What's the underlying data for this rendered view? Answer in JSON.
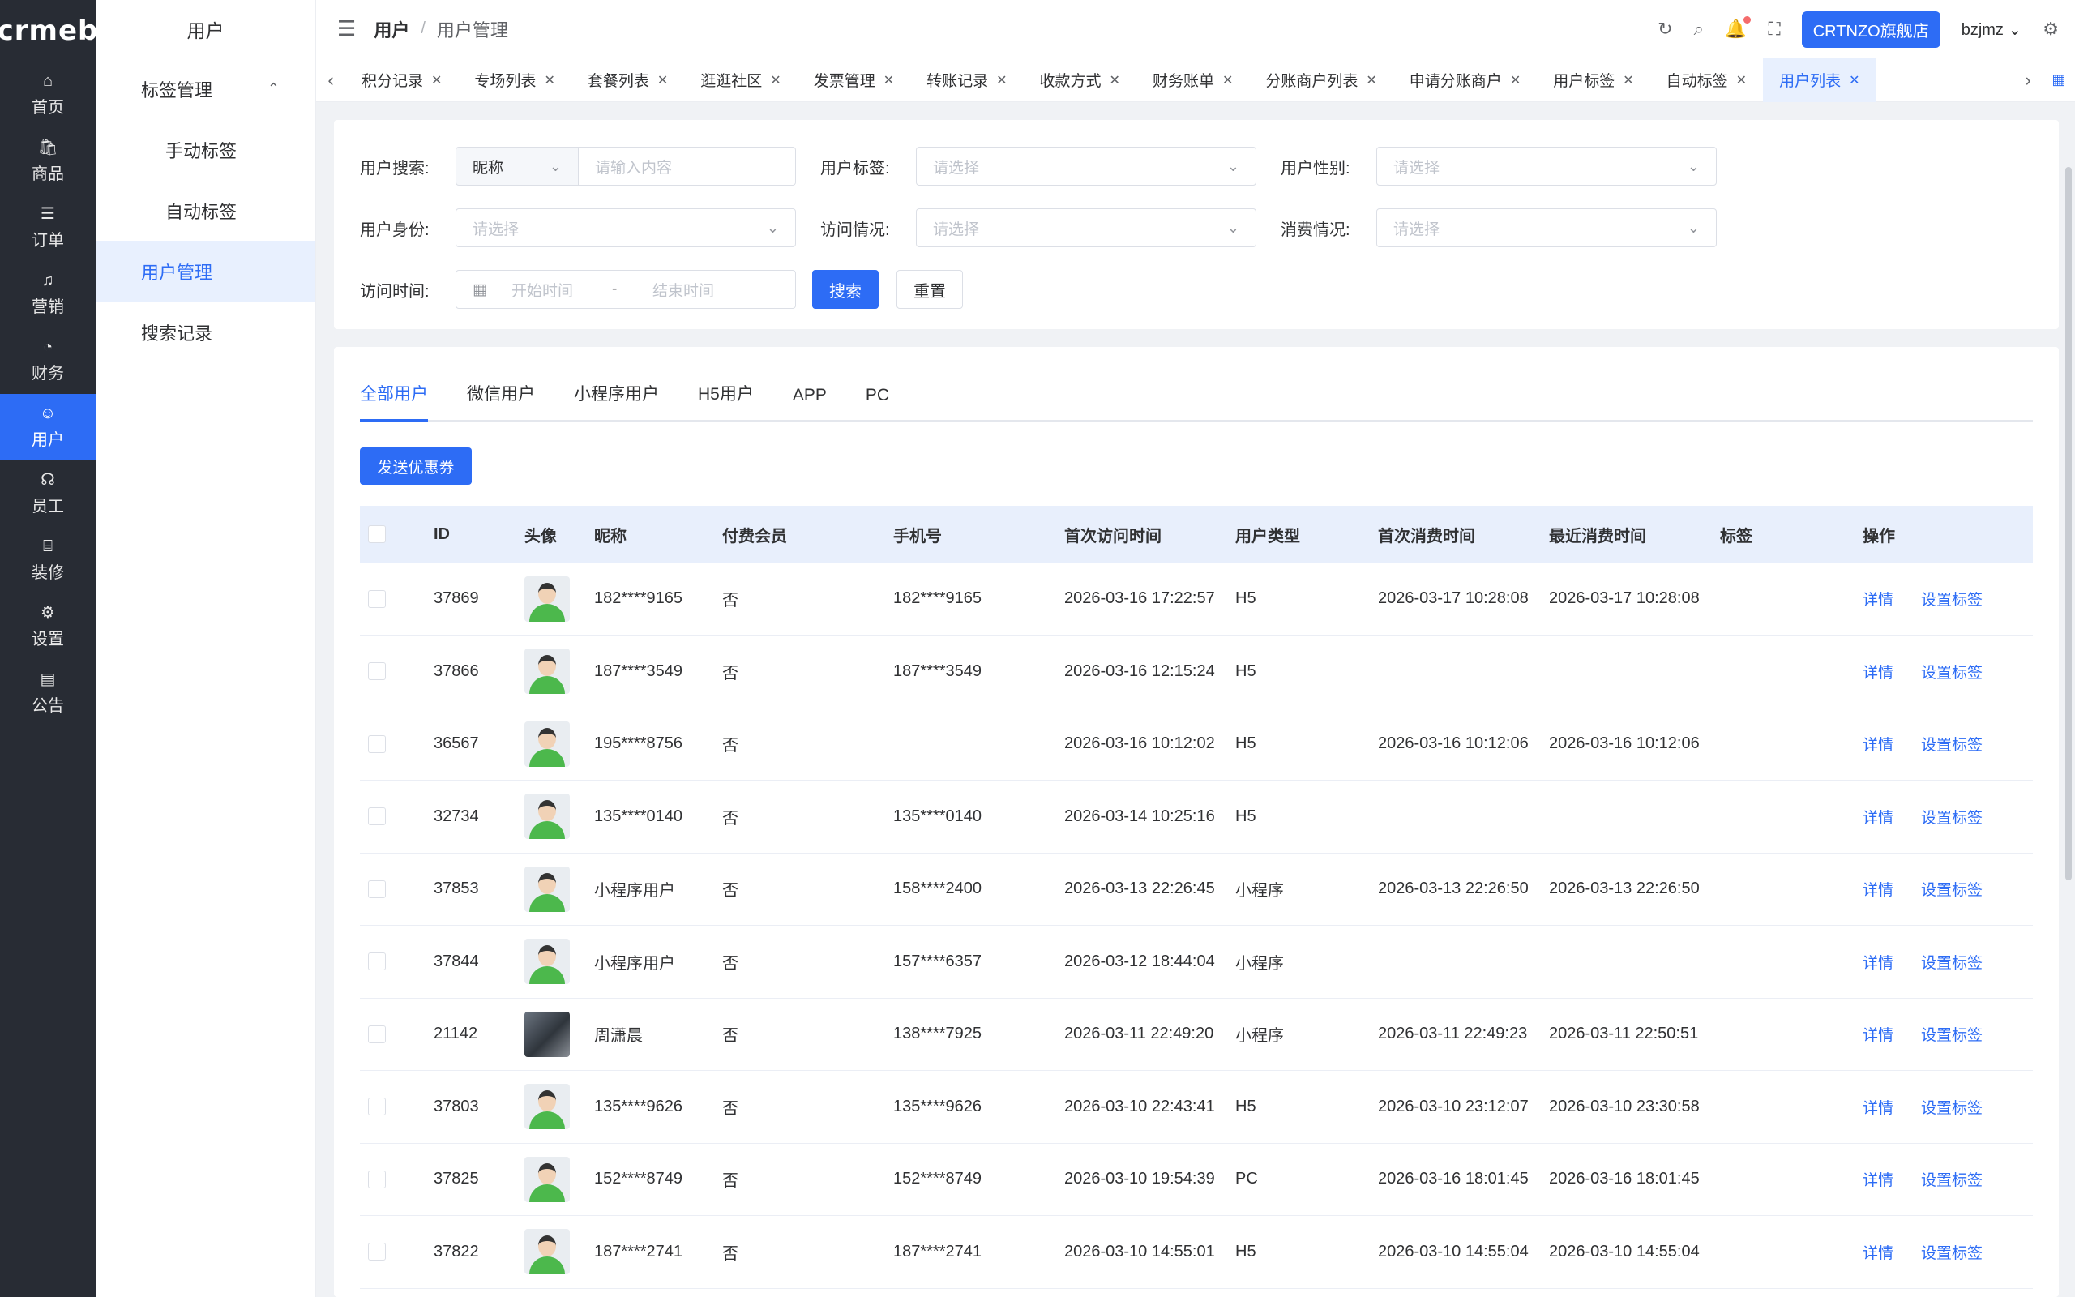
{
  "brand": {
    "logo_text": "crmeb"
  },
  "rail": [
    {
      "icon": "⌂",
      "label": "首页",
      "name": "rail-item-home"
    },
    {
      "icon": "🛍",
      "label": "商品",
      "name": "rail-item-goods"
    },
    {
      "icon": "☰",
      "label": "订单",
      "name": "rail-item-orders"
    },
    {
      "icon": "♫",
      "label": "营销",
      "name": "rail-item-marketing"
    },
    {
      "icon": "◔",
      "label": "财务",
      "name": "rail-item-finance"
    },
    {
      "icon": "☺",
      "label": "用户",
      "name": "rail-item-users"
    },
    {
      "icon": "☊",
      "label": "员工",
      "name": "rail-item-staff"
    },
    {
      "icon": "⌸",
      "label": "装修",
      "name": "rail-item-decor"
    },
    {
      "icon": "⚙",
      "label": "设置",
      "name": "rail-item-settings"
    },
    {
      "icon": "▤",
      "label": "公告",
      "name": "rail-item-notice"
    }
  ],
  "submenu": {
    "title": "用户",
    "items": [
      {
        "label": "标签管理",
        "caret": "⌃"
      },
      {
        "label": "手动标签"
      },
      {
        "label": "自动标签"
      },
      {
        "label": "用户管理"
      },
      {
        "label": "搜索记录"
      }
    ]
  },
  "header": {
    "crumb_main": "用户",
    "crumb_sep": "/",
    "crumb_sub": "用户管理",
    "store_button": "CRTNZO旗舰店",
    "username": "bzjmz"
  },
  "tabs": [
    "积分记录",
    "专场列表",
    "套餐列表",
    "逛逛社区",
    "发票管理",
    "转账记录",
    "收款方式",
    "财务账单",
    "分账商户列表",
    "申请分账商户",
    "用户标签",
    "自动标签",
    "用户列表"
  ],
  "search": {
    "user_search_label": "用户搜索:",
    "user_search_type": "昵称",
    "user_search_placeholder": "请输入内容",
    "tag_label": "用户标签:",
    "tag_placeholder": "请选择",
    "gender_label": "用户性别:",
    "gender_placeholder": "请选择",
    "identity_label": "用户身份:",
    "identity_placeholder": "请选择",
    "visit_label": "访问情况:",
    "visit_placeholder": "请选择",
    "consume_label": "消费情况:",
    "consume_placeholder": "请选择",
    "time_label": "访问时间:",
    "start_placeholder": "开始时间",
    "range_sep": "-",
    "end_placeholder": "结束时间",
    "search_button": "搜索",
    "reset_button": "重置"
  },
  "user_tabs": [
    "全部用户",
    "微信用户",
    "小程序用户",
    "H5用户",
    "APP",
    "PC"
  ],
  "coupon_button": "发送优惠券",
  "table": {
    "headers": [
      "ID",
      "头像",
      "昵称",
      "付费会员",
      "手机号",
      "首次访问时间",
      "用户类型",
      "首次消费时间",
      "最近消费时间",
      "标签",
      "操作"
    ],
    "action_detail": "详情",
    "action_tag": "设置标签",
    "rows": [
      {
        "id": "37869",
        "photo": false,
        "nickname": "182****9165",
        "paid": "否",
        "phone": "182****9165",
        "first_visit": "2026-03-16 17:22:57",
        "type": "H5",
        "first_consume": "2026-03-17 10:28:08",
        "last_consume": "2026-03-17 10:28:08"
      },
      {
        "id": "37866",
        "photo": false,
        "nickname": "187****3549",
        "paid": "否",
        "phone": "187****3549",
        "first_visit": "2026-03-16 12:15:24",
        "type": "H5",
        "first_consume": "",
        "last_consume": ""
      },
      {
        "id": "36567",
        "photo": false,
        "nickname": "195****8756",
        "paid": "否",
        "phone": "",
        "first_visit": "2026-03-16 10:12:02",
        "type": "H5",
        "first_consume": "2026-03-16 10:12:06",
        "last_consume": "2026-03-16 10:12:06"
      },
      {
        "id": "32734",
        "photo": false,
        "nickname": "135****0140",
        "paid": "否",
        "phone": "135****0140",
        "first_visit": "2026-03-14 10:25:16",
        "type": "H5",
        "first_consume": "",
        "last_consume": ""
      },
      {
        "id": "37853",
        "photo": false,
        "nickname": "小程序用户",
        "paid": "否",
        "phone": "158****2400",
        "first_visit": "2026-03-13 22:26:45",
        "type": "小程序",
        "first_consume": "2026-03-13 22:26:50",
        "last_consume": "2026-03-13 22:26:50"
      },
      {
        "id": "37844",
        "photo": false,
        "nickname": "小程序用户",
        "paid": "否",
        "phone": "157****6357",
        "first_visit": "2026-03-12 18:44:04",
        "type": "小程序",
        "first_consume": "",
        "last_consume": ""
      },
      {
        "id": "21142",
        "photo": true,
        "nickname": "周潇晨",
        "paid": "否",
        "phone": "138****7925",
        "first_visit": "2026-03-11 22:49:20",
        "type": "小程序",
        "first_consume": "2026-03-11 22:49:23",
        "last_consume": "2026-03-11 22:50:51"
      },
      {
        "id": "37803",
        "photo": false,
        "nickname": "135****9626",
        "paid": "否",
        "phone": "135****9626",
        "first_visit": "2026-03-10 22:43:41",
        "type": "H5",
        "first_consume": "2026-03-10 23:12:07",
        "last_consume": "2026-03-10 23:30:58"
      },
      {
        "id": "37825",
        "photo": false,
        "nickname": "152****8749",
        "paid": "否",
        "phone": "152****8749",
        "first_visit": "2026-03-10 19:54:39",
        "type": "PC",
        "first_consume": "2026-03-16 18:01:45",
        "last_consume": "2026-03-16 18:01:45"
      },
      {
        "id": "37822",
        "photo": false,
        "nickname": "187****2741",
        "paid": "否",
        "phone": "187****2741",
        "first_visit": "2026-03-10 14:55:01",
        "type": "H5",
        "first_consume": "2026-03-10 14:55:04",
        "last_consume": "2026-03-10 14:55:04"
      }
    ]
  },
  "colors": {
    "primary": "#2d6cf5",
    "rail_bg": "#282c34",
    "active_bg": "#e8f0fe"
  }
}
